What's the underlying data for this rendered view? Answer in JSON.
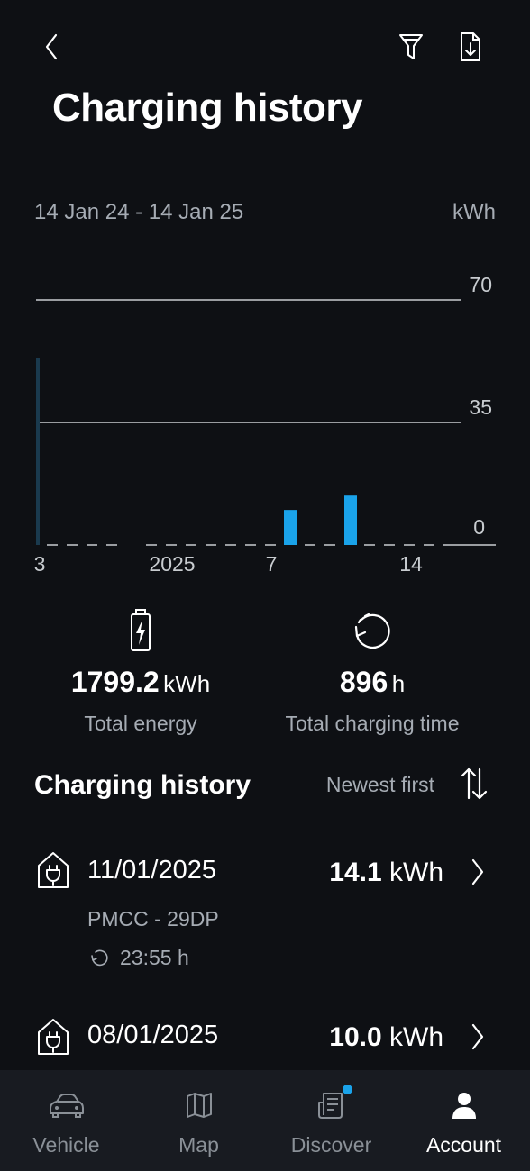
{
  "header": {
    "title": "Charging history",
    "back_icon": "chevron-left-icon",
    "filter_icon": "filter-icon",
    "export_icon": "file-download-icon"
  },
  "chart": {
    "date_range": "14 Jan 24 - 14 Jan 25",
    "unit": "kWh"
  },
  "chart_data": {
    "type": "bar",
    "ylabel": "kWh",
    "ylim": [
      0,
      70
    ],
    "y_ticks": [
      "70",
      "35",
      "0"
    ],
    "x_tick_labels": [
      "3",
      "2025",
      "7",
      "14"
    ],
    "bars": [
      {
        "label": "8",
        "value": 10.0
      },
      {
        "label": "11",
        "value": 14.1
      }
    ],
    "color": "#1aa3ea",
    "grid": true
  },
  "stats": {
    "energy": {
      "value": "1799.2",
      "unit": "kWh",
      "label": "Total energy",
      "icon": "battery-charging-icon"
    },
    "time": {
      "value": "896",
      "unit": "h",
      "label": "Total charging time",
      "icon": "refresh-icon"
    }
  },
  "history": {
    "title": "Charging history",
    "sort_label": "Newest first",
    "sort_icon": "sort-arrows-icon",
    "sessions": [
      {
        "date": "11/01/2025",
        "location": "PMCC - 29DP",
        "duration": "23:55 h",
        "energy": "14.1",
        "unit": "kWh",
        "icon": "home-charger-icon"
      },
      {
        "date": "08/01/2025",
        "energy": "10.0",
        "unit": "kWh",
        "icon": "home-charger-icon"
      }
    ]
  },
  "nav": {
    "items": [
      {
        "label": "Vehicle",
        "icon": "car-icon"
      },
      {
        "label": "Map",
        "icon": "map-icon"
      },
      {
        "label": "Discover",
        "icon": "news-icon",
        "badge_color": "#1aa3ea"
      },
      {
        "label": "Account",
        "icon": "person-icon",
        "active": true
      }
    ]
  },
  "colors": {
    "background": "#0e1014",
    "accent": "#1aa3ea",
    "muted_text": "#a6acb4",
    "nav_background": "#181b21"
  }
}
